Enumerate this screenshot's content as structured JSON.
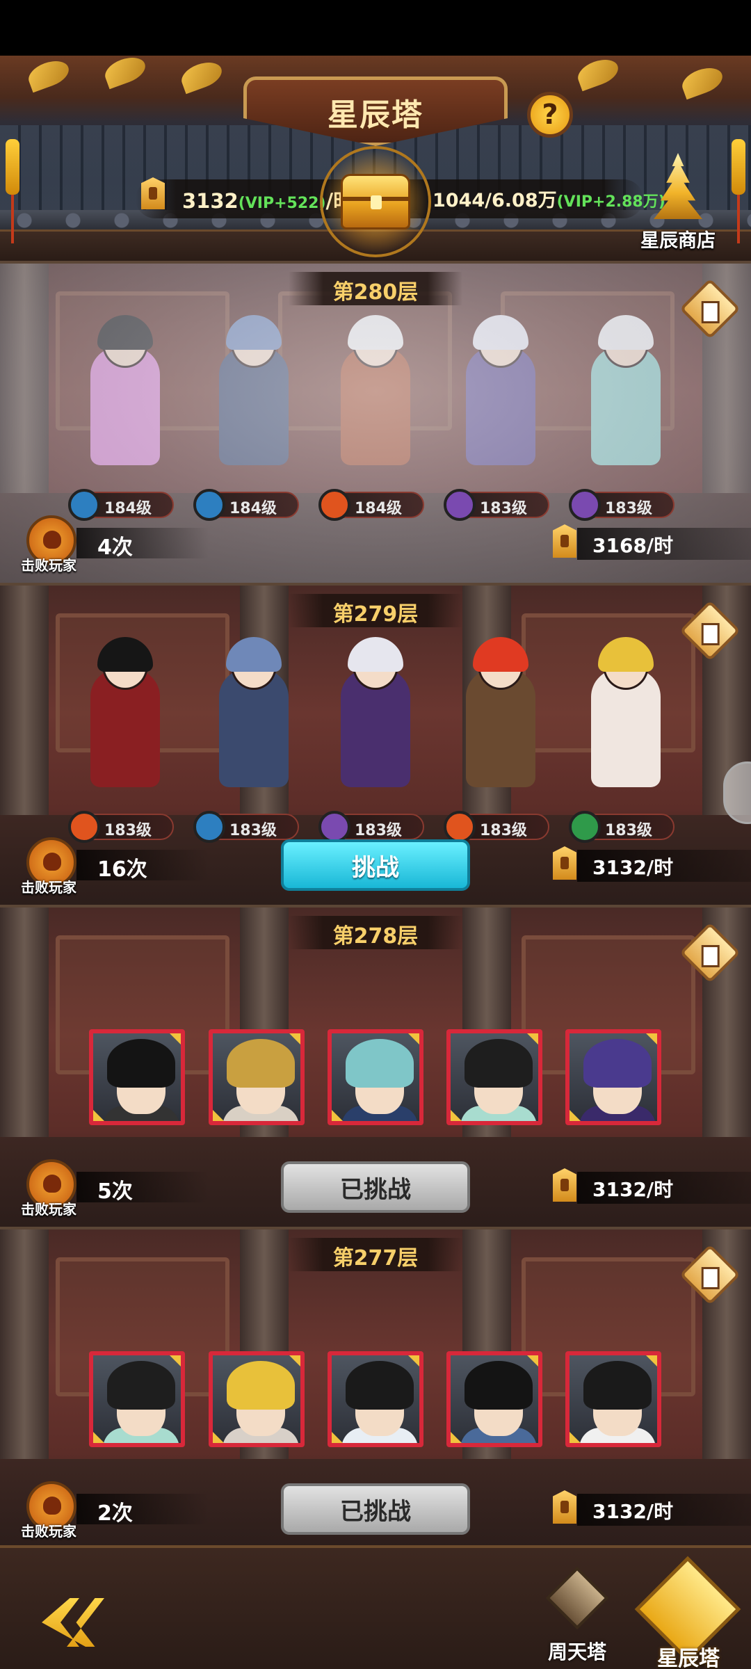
{
  "header": {
    "title": "星辰塔",
    "help_icon": "question-mark",
    "income_left": {
      "value": "3132",
      "vip": "(VIP+522)",
      "unit": "/时"
    },
    "income_right": {
      "value": "1044/6.08万",
      "vip": "(VIP+2.88万)"
    },
    "shop_label": "星辰商店"
  },
  "floors": [
    {
      "label": "第280层",
      "state": "foggy",
      "heroes": [
        {
          "level": "184级",
          "element": "water"
        },
        {
          "level": "184级",
          "element": "water"
        },
        {
          "level": "184级",
          "element": "fire"
        },
        {
          "level": "183级",
          "element": "moon"
        },
        {
          "level": "183级",
          "element": "moon"
        }
      ],
      "defeat_label": "击败玩家",
      "defeat_count": "4次",
      "reward": "3168/时"
    },
    {
      "label": "第279层",
      "state": "challengeable",
      "heroes": [
        {
          "level": "183级",
          "element": "fire"
        },
        {
          "level": "183级",
          "element": "water"
        },
        {
          "level": "183级",
          "element": "moon"
        },
        {
          "level": "183级",
          "element": "fire"
        },
        {
          "level": "183级",
          "element": "wood"
        }
      ],
      "defeat_label": "击败玩家",
      "defeat_count": "16次",
      "button": "挑战",
      "reward": "3132/时"
    },
    {
      "label": "第278层",
      "state": "challenged",
      "defeat_label": "击败玩家",
      "defeat_count": "5次",
      "button": "已挑战",
      "reward": "3132/时"
    },
    {
      "label": "第277层",
      "state": "challenged",
      "defeat_label": "击败玩家",
      "defeat_count": "2次",
      "button": "已挑战",
      "reward": "3132/时"
    }
  ],
  "nav": {
    "back_icon": "back-arrow",
    "zhoutian_label": "周天塔",
    "star_shop_label": "星辰塔"
  },
  "colors": {
    "accent_gold": "#f7cf6a",
    "vip_green": "#63e25a",
    "challenge_cyan": "#19b7d6",
    "portrait_frame_red": "#d8283a"
  }
}
